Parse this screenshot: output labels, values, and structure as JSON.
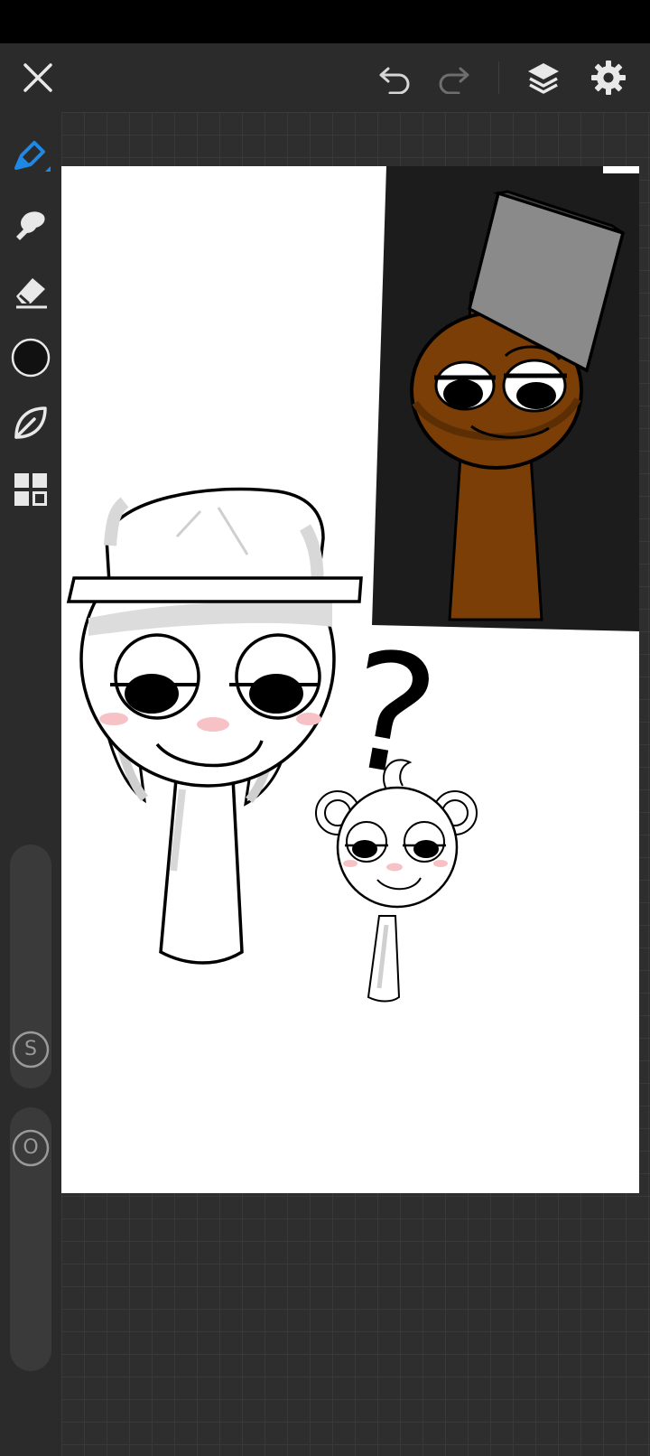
{
  "app": {
    "toolbar_icons": [
      "close-icon",
      "undo-icon",
      "redo-icon",
      "layers-icon",
      "settings-icon"
    ],
    "sidebar_icons": [
      "pen-icon",
      "smudge-icon",
      "eraser-icon",
      "color-swatch",
      "shape-icon",
      "gallery-grid-icon"
    ]
  },
  "colors": {
    "accent": "#1e88e5",
    "current_color": "#111111",
    "background": "#2b2b2b"
  },
  "sliders": {
    "size_label": "S",
    "opacity_label": "O"
  },
  "canvas": {
    "question_mark": "?"
  }
}
